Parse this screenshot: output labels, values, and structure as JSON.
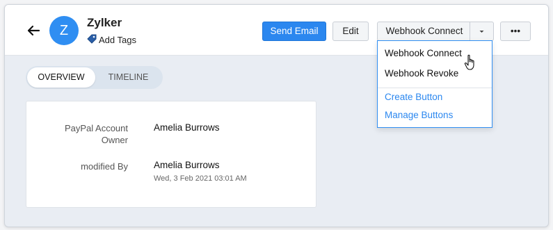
{
  "header": {
    "avatar_letter": "Z",
    "name": "Zylker",
    "add_tags": "Add Tags"
  },
  "toolbar": {
    "send_email": "Send Email",
    "edit": "Edit",
    "webhook_connect": "Webhook Connect",
    "more": "•••"
  },
  "dropdown": {
    "items": [
      "Webhook Connect",
      "Webhook Revoke"
    ],
    "links": [
      "Create Button",
      "Manage Buttons"
    ]
  },
  "tabs": [
    "OVERVIEW",
    "TIMELINE"
  ],
  "details": [
    {
      "label": "PayPal Account Owner",
      "label_line1": "PayPal Account",
      "label_line2": "Owner",
      "value": "Amelia Burrows"
    },
    {
      "label": "modified By",
      "value": "Amelia Burrows",
      "sub": "Wed, 3 Feb 2021 03:01 AM"
    }
  ],
  "colors": {
    "accent": "#2b87ef",
    "avatar": "#2f8ef2"
  }
}
